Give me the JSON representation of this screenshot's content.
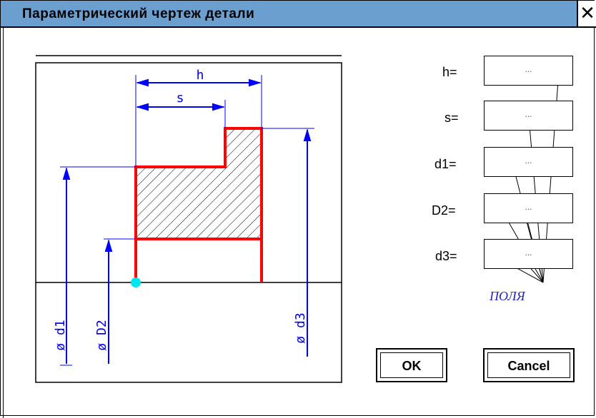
{
  "window": {
    "title": "Параметрический чертеж детали",
    "close_glyph": "✕"
  },
  "drawing": {
    "dim_h": "h",
    "dim_s": "s",
    "dim_d1": "ø d1",
    "dim_D2": "ø D2",
    "dim_d3": "ø d3"
  },
  "fields": [
    {
      "label": "h=",
      "value": "..."
    },
    {
      "label": "s=",
      "value": "..."
    },
    {
      "label": "d1=",
      "value": "..."
    },
    {
      "label": "D2=",
      "value": "..."
    },
    {
      "label": "d3=",
      "value": "..."
    }
  ],
  "fields_caption": "ПОЛЯ",
  "buttons": {
    "ok": "OK",
    "cancel": "Cancel"
  },
  "colors": {
    "titlebar": "#6a9fd0",
    "dimension": "#0000ff",
    "contour": "#ff0000",
    "base_point": "#00e5ee"
  }
}
